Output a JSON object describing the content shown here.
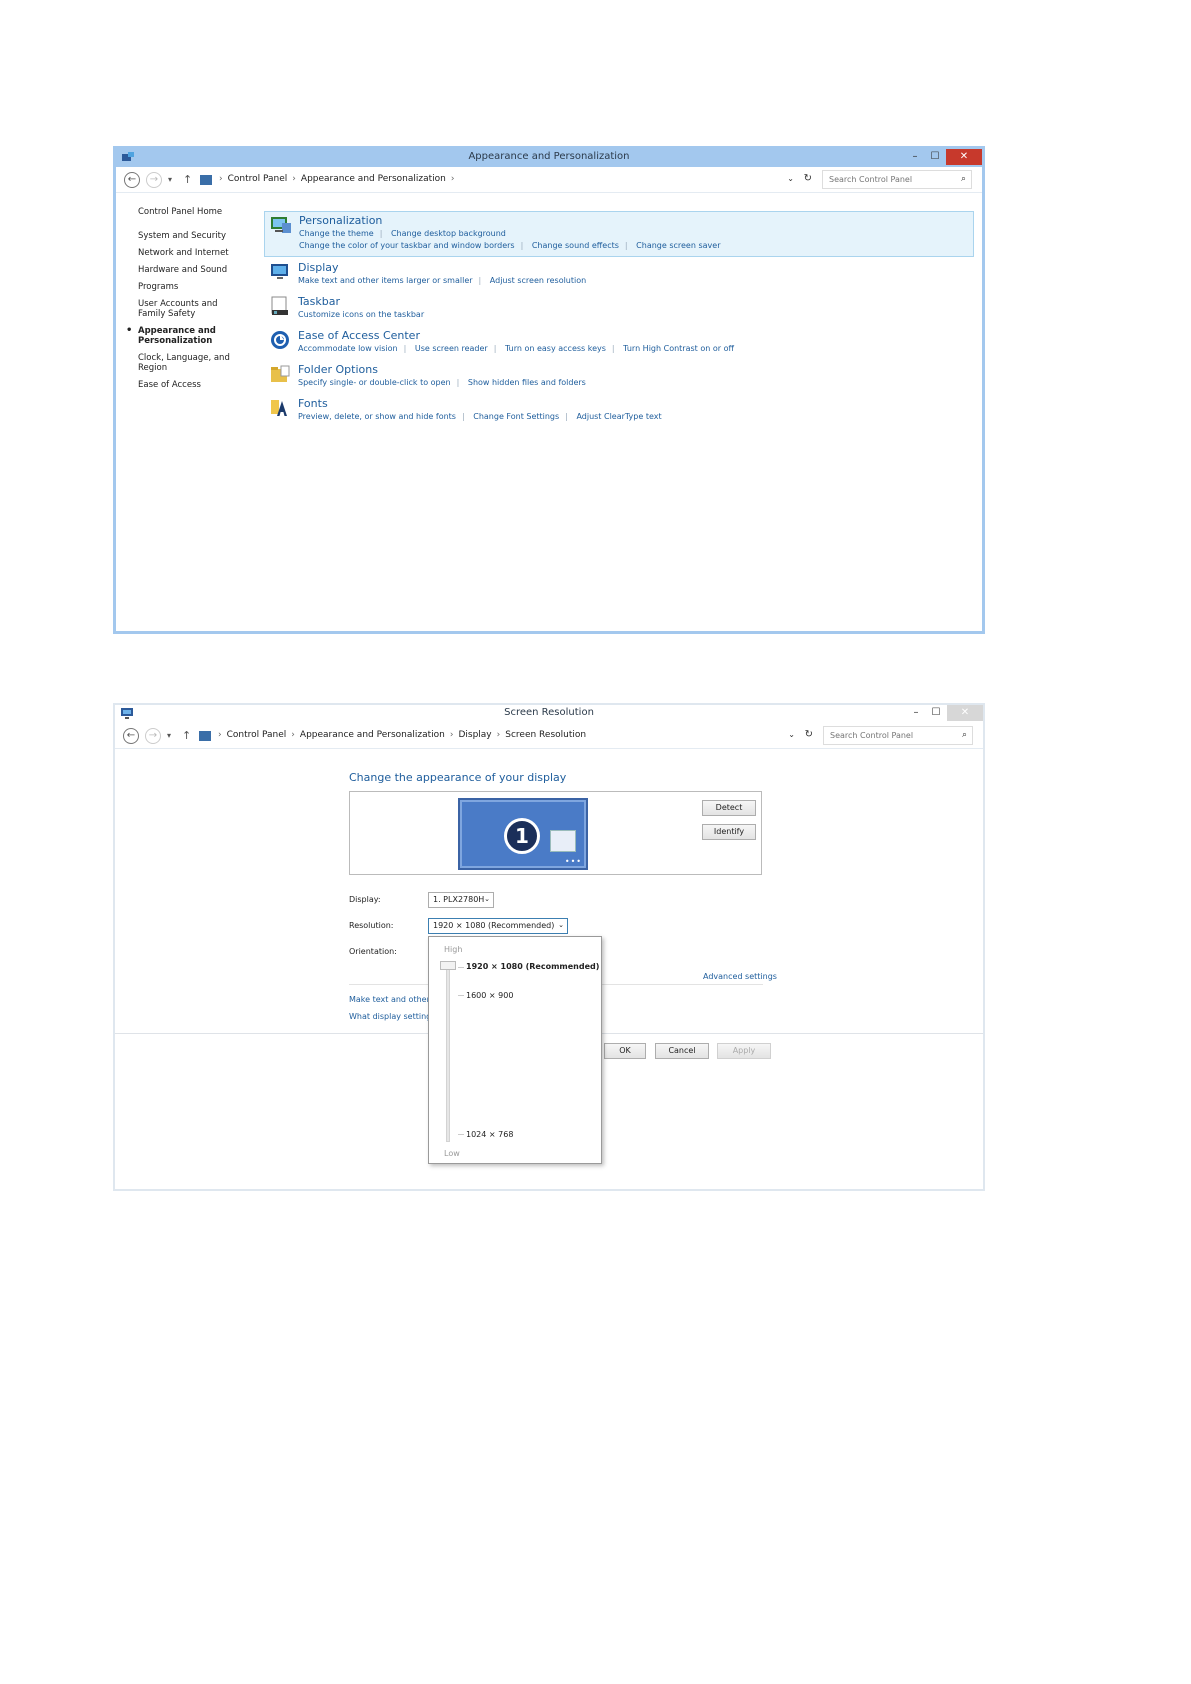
{
  "window1": {
    "title": "Appearance and Personalization",
    "window_controls": {
      "minimize": "–",
      "maximize": "☐",
      "close": "✕"
    },
    "breadcrumb": [
      "Control Panel",
      "Appearance and Personalization"
    ],
    "search_placeholder": "Search Control Panel",
    "sidebar": {
      "home": "Control Panel Home",
      "items": [
        "System and Security",
        "Network and Internet",
        "Hardware and Sound",
        "Programs",
        "User Accounts and Family Safety",
        "Appearance and Personalization",
        "Clock, Language, and Region",
        "Ease of Access"
      ]
    },
    "categories": [
      {
        "title": "Personalization",
        "icon": "personalization-icon",
        "links": [
          "Change the theme",
          "Change desktop background",
          "Change the color of your taskbar and window borders",
          "Change sound effects",
          "Change screen saver"
        ]
      },
      {
        "title": "Display",
        "icon": "display-icon",
        "links": [
          "Make text and other items larger or smaller",
          "Adjust screen resolution"
        ]
      },
      {
        "title": "Taskbar",
        "icon": "taskbar-icon",
        "links": [
          "Customize icons on the taskbar"
        ]
      },
      {
        "title": "Ease of Access Center",
        "icon": "ease-of-access-icon",
        "links": [
          "Accommodate low vision",
          "Use screen reader",
          "Turn on easy access keys",
          "Turn High Contrast on or off"
        ]
      },
      {
        "title": "Folder Options",
        "icon": "folder-options-icon",
        "links": [
          "Specify single- or double-click to open",
          "Show hidden files and folders"
        ]
      },
      {
        "title": "Fonts",
        "icon": "fonts-icon",
        "links": [
          "Preview, delete, or show and hide fonts",
          "Change Font Settings",
          "Adjust ClearType text"
        ]
      }
    ]
  },
  "window2": {
    "title": "Screen Resolution",
    "window_controls": {
      "minimize": "–",
      "maximize": "☐",
      "close": "✕"
    },
    "breadcrumb": [
      "Control Panel",
      "Appearance and Personalization",
      "Display",
      "Screen Resolution"
    ],
    "search_placeholder": "Search Control Panel",
    "heading": "Change the appearance of your display",
    "monitor_number": "1",
    "detect_label": "Detect",
    "identify_label": "Identify",
    "display_label": "Display:",
    "display_value": "1. PLX2780H",
    "resolution_label": "Resolution:",
    "resolution_value": "1920 × 1080 (Recommended)",
    "orientation_label": "Orientation:",
    "advanced_link": "Advanced settings",
    "link1": "Make text and other",
    "link2": "What display setting",
    "ok_label": "OK",
    "cancel_label": "Cancel",
    "apply_label": "Apply",
    "popup": {
      "high_label": "High",
      "low_label": "Low",
      "options": [
        "1920 × 1080 (Recommended)",
        "1600 × 900",
        "1024 × 768"
      ],
      "slider_level": 1.0
    }
  },
  "colors": {
    "title_bar": "#a3c8ee",
    "link": "#1e5d9c",
    "close_button": "#c7392c",
    "selection": "#e5f3fb"
  }
}
